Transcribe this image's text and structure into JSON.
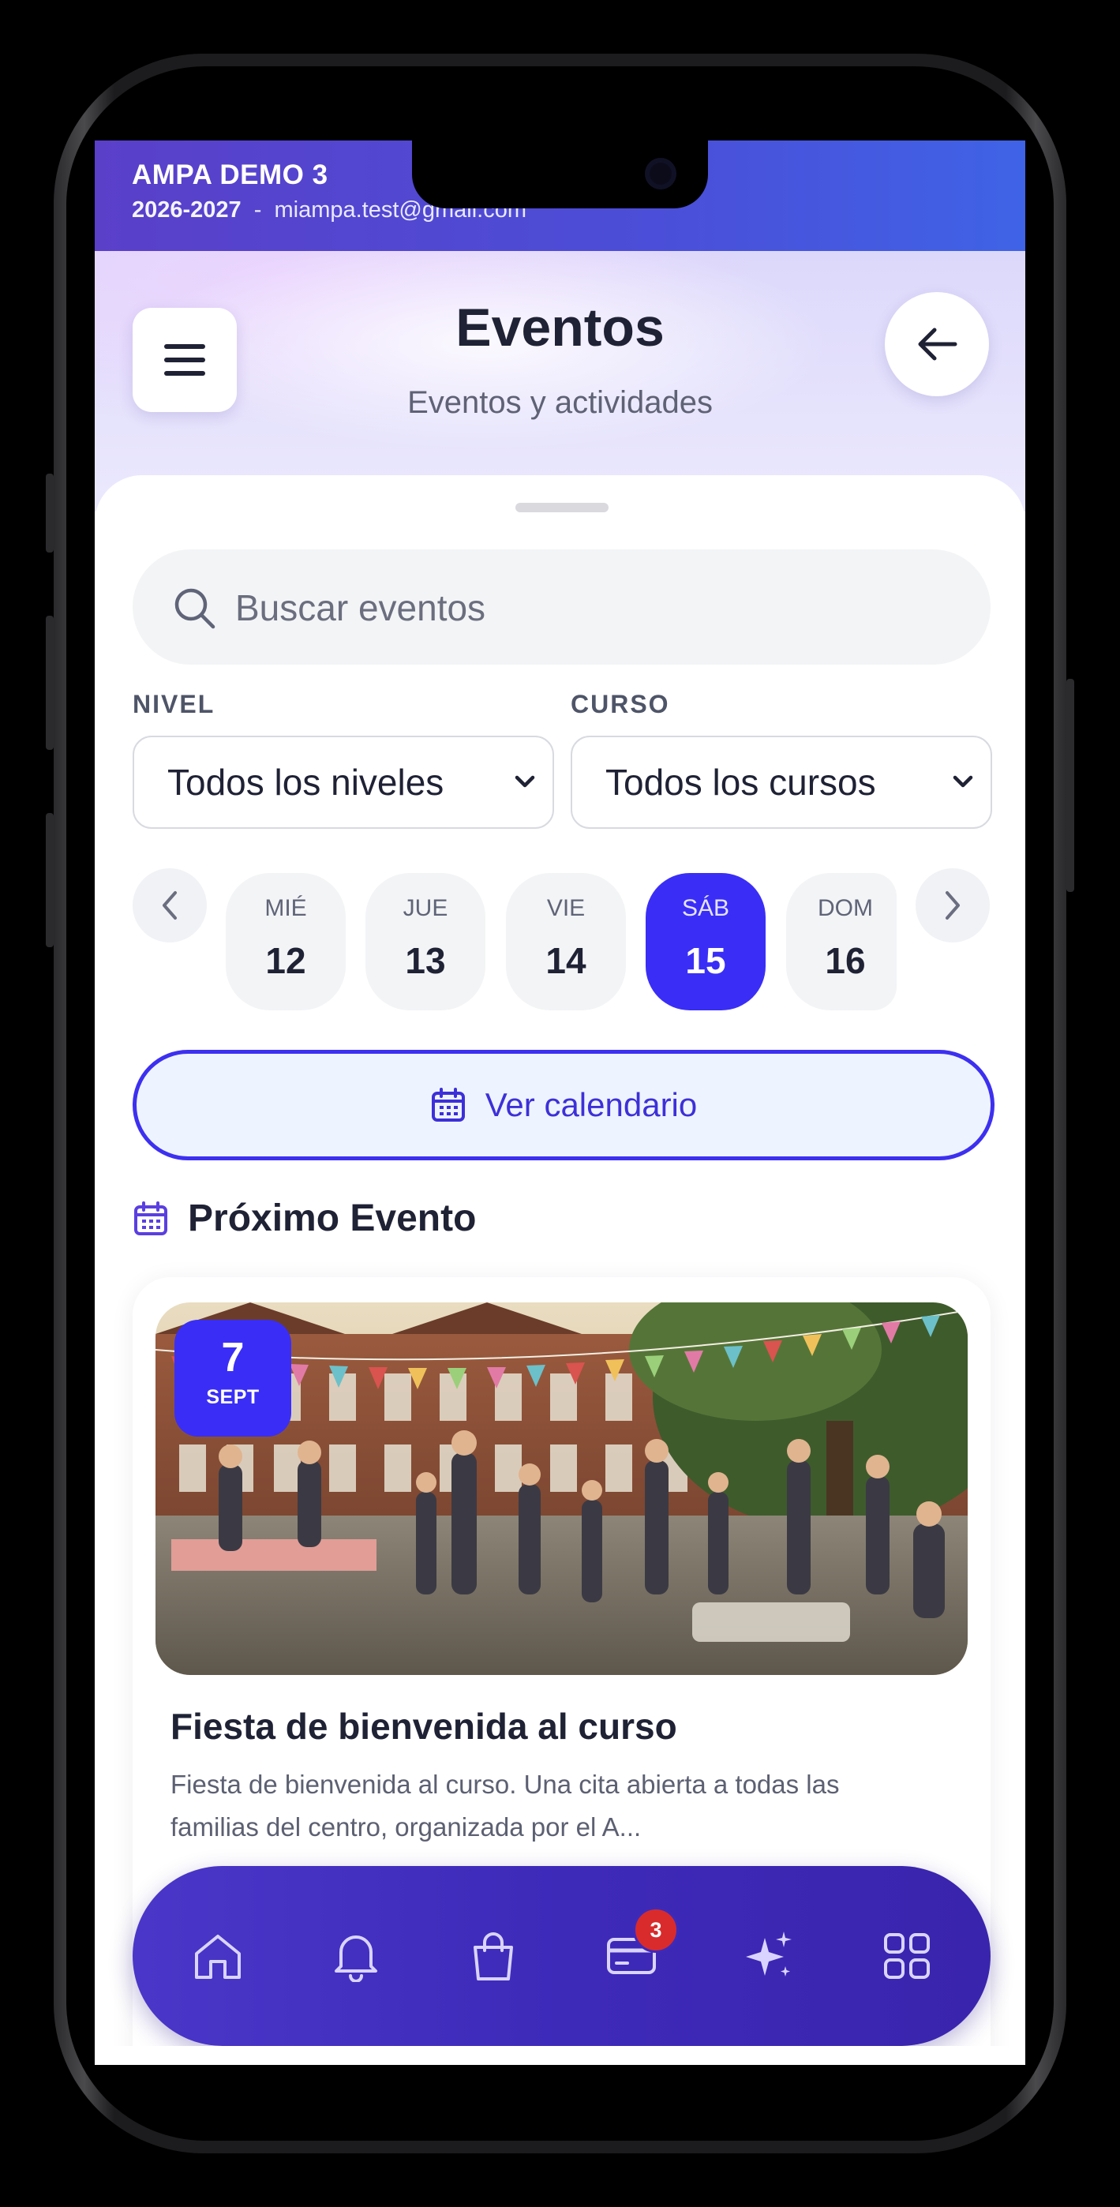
{
  "org": {
    "name": "AMPA DEMO 3",
    "year": "2026-2027",
    "separator": "-",
    "email": "miampa.test@gmail.com"
  },
  "header": {
    "title": "Eventos",
    "subtitle": "Eventos y actividades"
  },
  "search": {
    "placeholder": "Buscar eventos",
    "value": ""
  },
  "filters": {
    "nivel": {
      "label": "NIVEL",
      "value": "Todos los niveles"
    },
    "curso": {
      "label": "CURSO",
      "value": "Todos los cursos"
    }
  },
  "days": [
    {
      "name": "MIÉ",
      "num": "12"
    },
    {
      "name": "JUE",
      "num": "13"
    },
    {
      "name": "VIE",
      "num": "14"
    },
    {
      "name": "SÁB",
      "num": "15"
    },
    {
      "name": "DOM",
      "num": "16"
    }
  ],
  "selected_day": "15",
  "calendar_button": {
    "label": "Ver calendario"
  },
  "section": {
    "title": "Próximo Evento"
  },
  "event": {
    "day": "7",
    "month": "SEPT",
    "title": "Fiesta de bienvenida al curso",
    "description": "Fiesta de bienvenida al curso. Una cita abierta a todas las familias del centro, organizada por el A..."
  },
  "tabbar": {
    "items": [
      "home-icon",
      "bell-icon",
      "bag-icon",
      "card-icon",
      "sparkles-icon",
      "grid-icon"
    ],
    "badge": "3"
  },
  "colors": {
    "accent": "#3a2ef6",
    "tabbar": "#3e2ab9",
    "badge": "#d92b2b"
  }
}
